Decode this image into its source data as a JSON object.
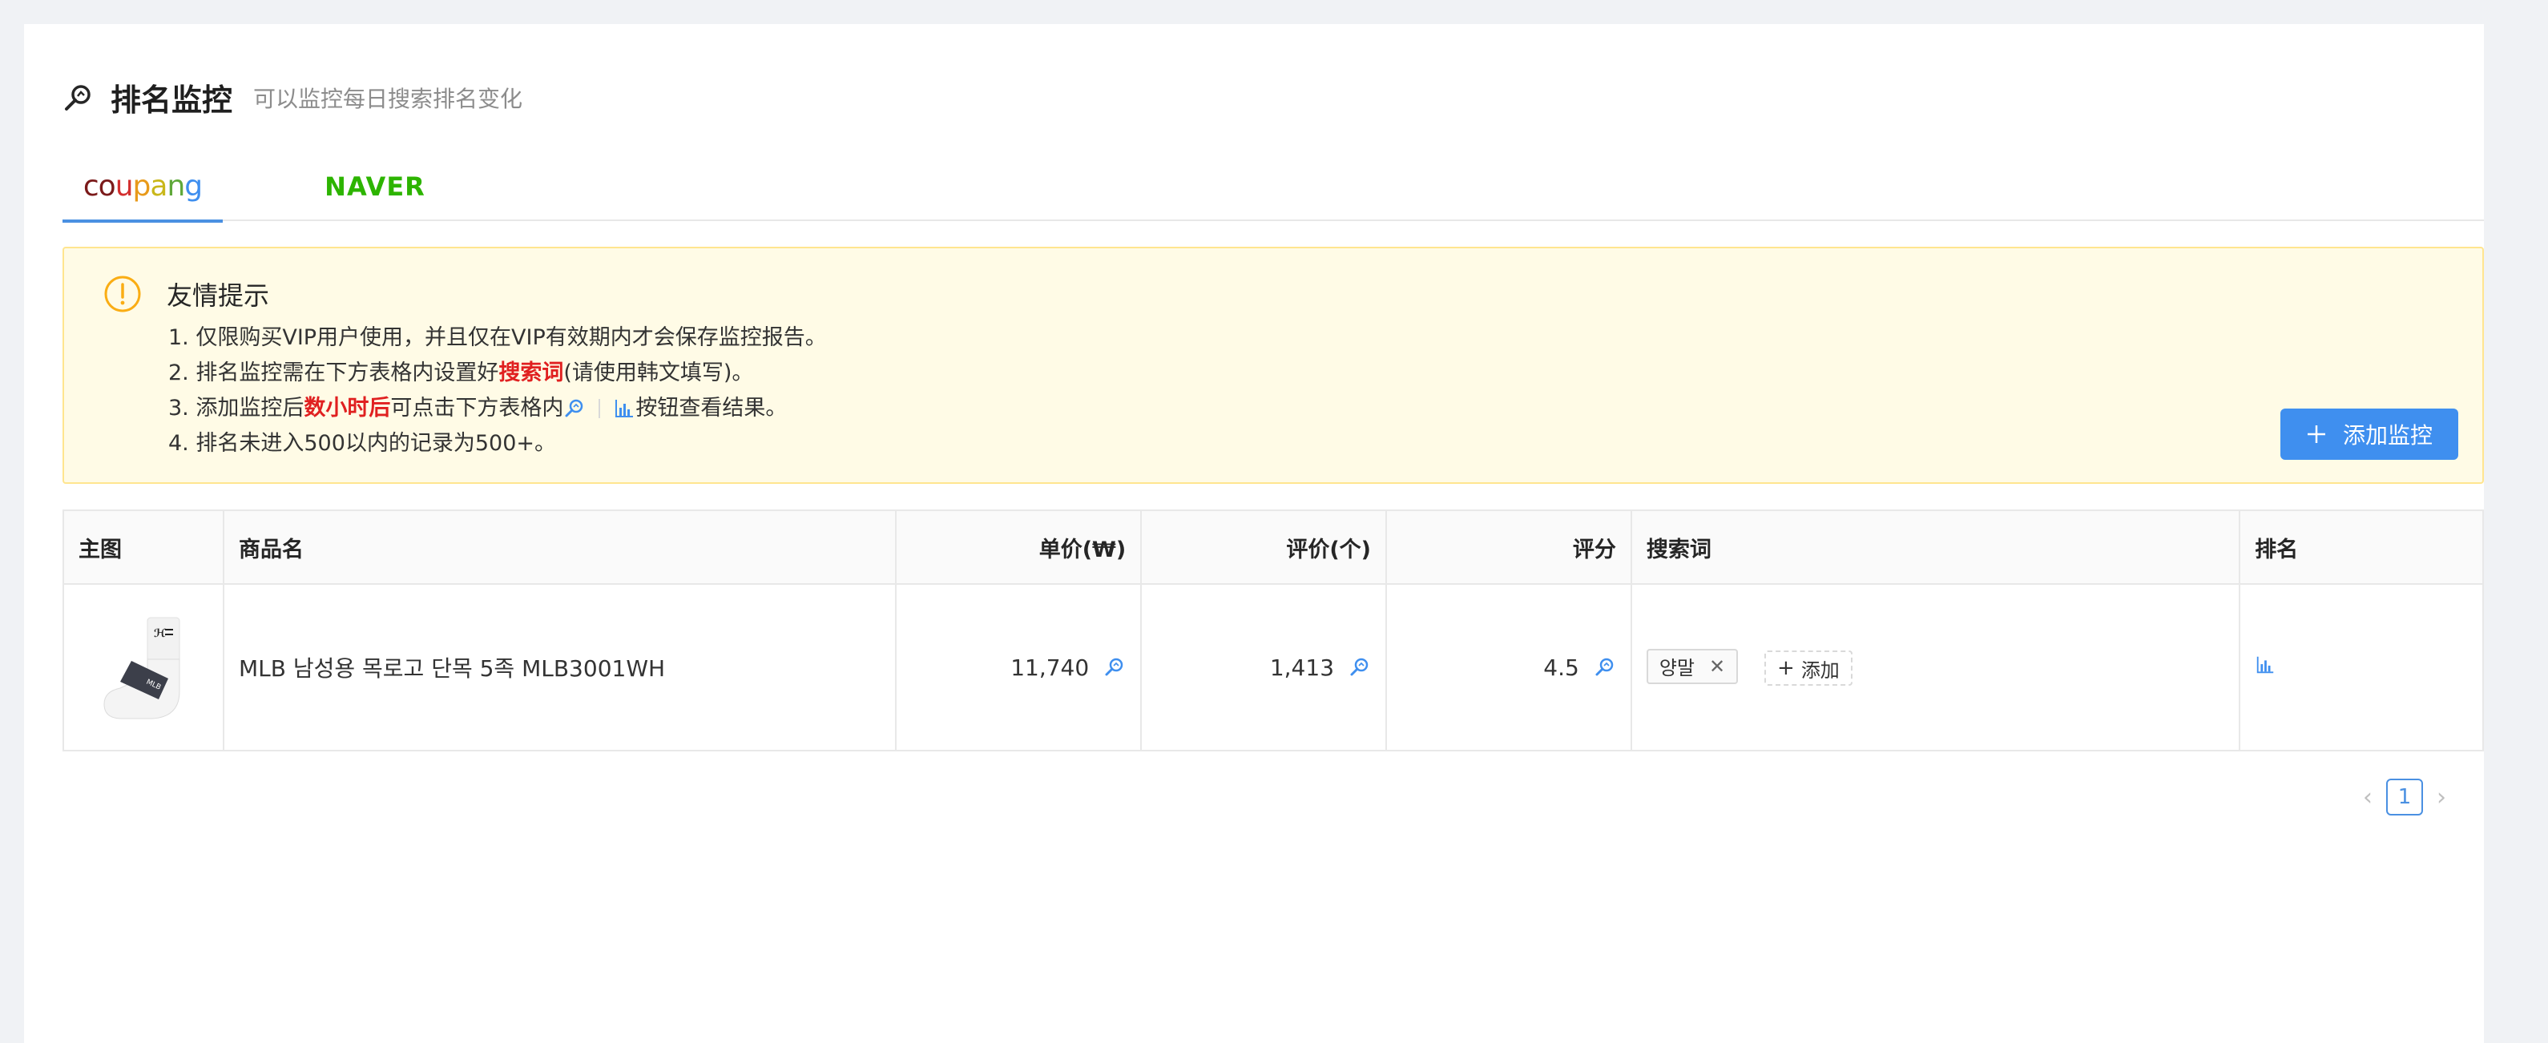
{
  "header": {
    "title": "排名监控",
    "subtitle": "可以监控每日搜索排名变化"
  },
  "tabs": [
    {
      "label": "coupang",
      "active": true
    },
    {
      "label": "NAVER",
      "active": false
    }
  ],
  "notice": {
    "title": "友情提示",
    "items": {
      "item1": "1. 仅限购买VIP用户使用，并且仅在VIP有效期内才会保存监控报告。",
      "item2_pre": "2. 排名监控需在下方表格内设置好",
      "item2_hl": "搜索词",
      "item2_post": "(请使用韩文填写)。",
      "item3_pre": "3. 添加监控后",
      "item3_hl": "数小时后",
      "item3_mid": "可点击下方表格内",
      "item3_post": "按钮查看结果。",
      "item4": "4. 排名未进入500以内的记录为500+。"
    },
    "add_button": "添加监控"
  },
  "table": {
    "columns": {
      "image": "主图",
      "name": "商品名",
      "price": "单价(₩)",
      "reviews": "评价(个)",
      "rating": "评分",
      "keywords": "搜索词",
      "rank": "排名"
    },
    "rows": [
      {
        "name": "MLB 남성용 목로고 단목 5족 MLB3001WH",
        "price": "11,740",
        "reviews": "1,413",
        "rating": "4.5",
        "keyword": "양말",
        "add_keyword": "添加"
      }
    ]
  },
  "pagination": {
    "current": "1"
  },
  "colors": {
    "primary": "#3f8fef",
    "highlight": "#e02020",
    "notice_bg": "#fffbe6",
    "naver_green": "#2db400"
  }
}
